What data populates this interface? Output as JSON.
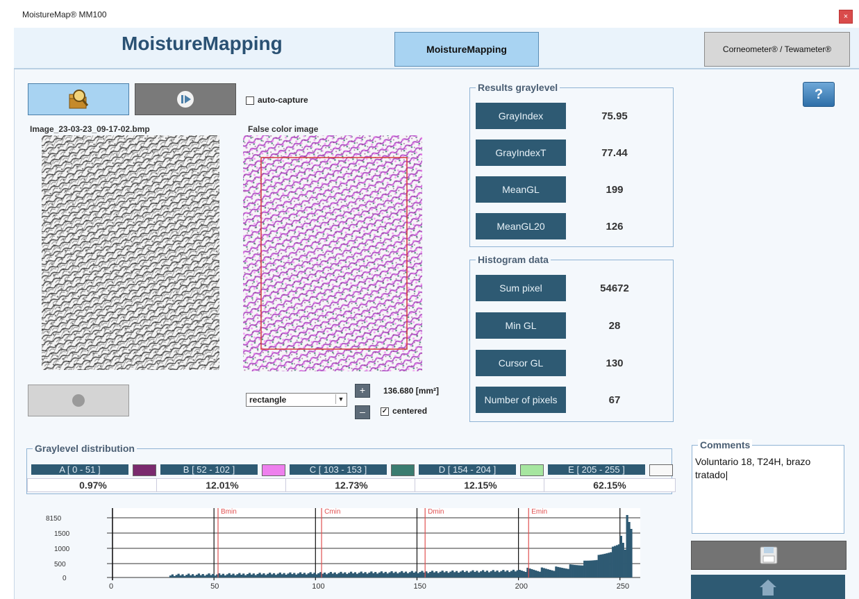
{
  "window": {
    "title": "MoistureMap® MM100",
    "close_glyph": "×"
  },
  "header": {
    "app_title": "MoistureMapping",
    "tab_moisture": "MoistureMapping",
    "tab_corneometer": "Corneometer® / Tewameter®"
  },
  "toolbar": {
    "auto_capture": "auto-capture",
    "open_icon": "folder-search-icon",
    "play_icon": "play-icon"
  },
  "images": {
    "filename": "Image_23-03-23_09-17-02.bmp",
    "false_color_caption": "False color image"
  },
  "selection": {
    "shape": "rectangle",
    "plus": "+",
    "minus": "–",
    "area": "136.680 [mm²]",
    "centered": "centered",
    "centered_checked": "✓"
  },
  "results": {
    "title": "Results graylevel",
    "rows": [
      {
        "label": "GrayIndex",
        "value": "75.95"
      },
      {
        "label": "GrayIndexT",
        "value": "77.44"
      },
      {
        "label": "MeanGL",
        "value": "199"
      },
      {
        "label": "MeanGL20",
        "value": "126"
      }
    ]
  },
  "histogram_data": {
    "title": "Histogram data",
    "rows": [
      {
        "label": "Sum pixel",
        "value": "54672"
      },
      {
        "label": "Min GL",
        "value": "28"
      },
      {
        "label": "Cursor GL",
        "value": "130"
      },
      {
        "label": "Number of pixels",
        "value": "67"
      }
    ]
  },
  "distribution": {
    "title": "Graylevel distribution",
    "classes": [
      {
        "label": "A [ 0 - 51 ]",
        "pct": "0.97%",
        "color": "#7a2a6e"
      },
      {
        "label": "B [ 52 - 102 ]",
        "pct": "12.01%",
        "color": "#ee80ee"
      },
      {
        "label": "C [ 103 - 153 ]",
        "pct": "12.73%",
        "color": "#3a7c70"
      },
      {
        "label": "D [ 154 - 204 ]",
        "pct": "12.15%",
        "color": "#a6e6a0"
      },
      {
        "label": "E [ 205 - 255 ]",
        "pct": "62.15%",
        "color": "#f8f8f8"
      }
    ]
  },
  "comments": {
    "title": "Comments",
    "text": "Voluntario 18, T24H, brazo tratado|"
  },
  "actions": {
    "help": "?",
    "save_icon": "floppy-disk-icon",
    "home_icon": "home-icon"
  },
  "chart_data": {
    "type": "bar",
    "title": "",
    "xlabel": "",
    "ylabel": "",
    "xlim": [
      0,
      260
    ],
    "x_ticks": [
      "0",
      "50",
      "100",
      "150",
      "200",
      "250"
    ],
    "y_ticks": [
      "8150",
      "1500",
      "1000",
      "500",
      "0"
    ],
    "markers": [
      {
        "label": "Bmin",
        "x": 52
      },
      {
        "label": "Cmin",
        "x": 103
      },
      {
        "label": "Dmin",
        "x": 154
      },
      {
        "label": "Emin",
        "x": 205
      }
    ],
    "marker_color": "#e05050",
    "bar_color": "#2e5a73"
  }
}
